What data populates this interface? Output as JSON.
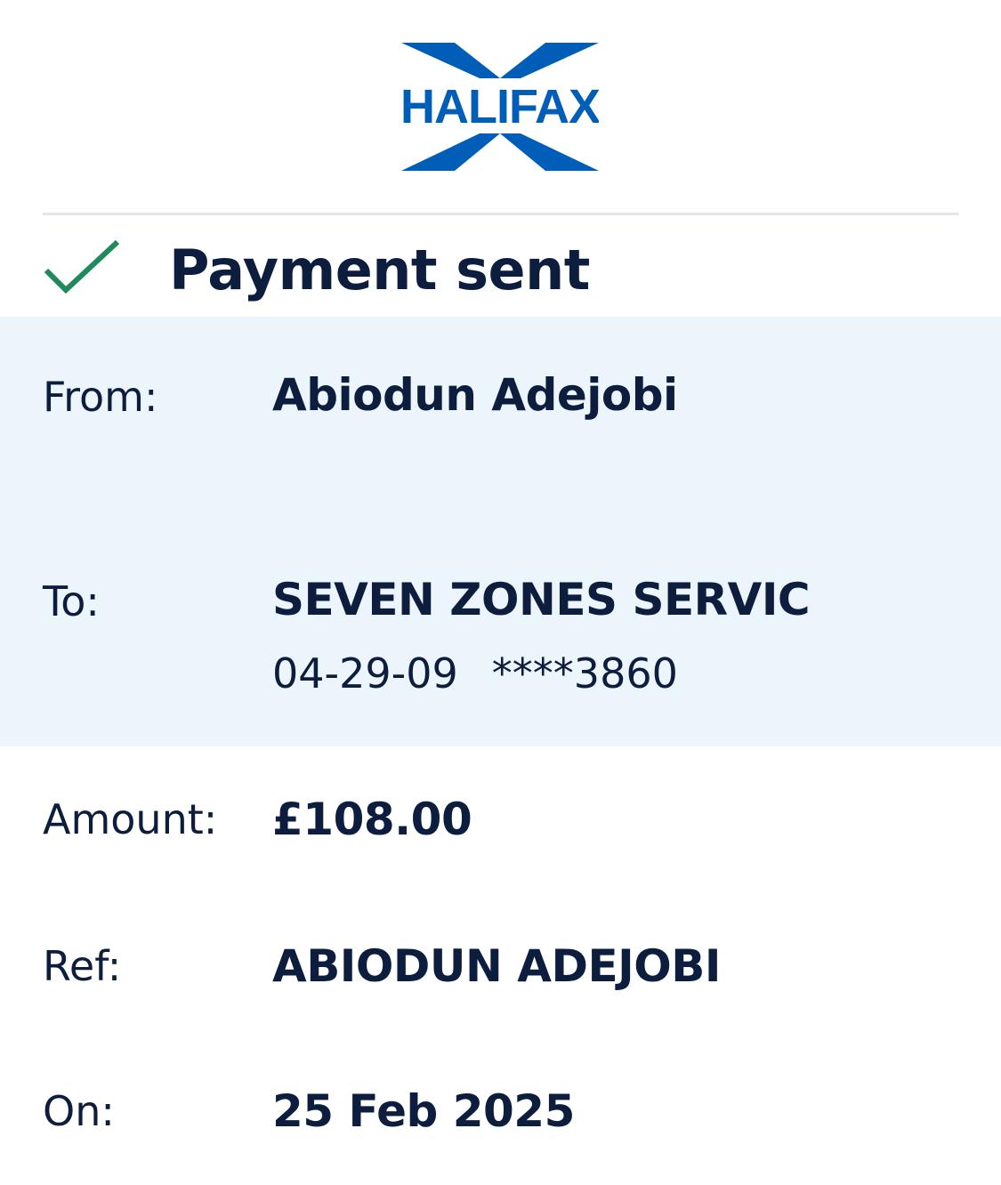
{
  "brand": {
    "name": "HALIFAX",
    "color": "#005eb8",
    "logo_icon": "halifax-x-logo-icon"
  },
  "status": {
    "icon": "checkmark-icon",
    "icon_color": "#1f8a5a",
    "title": "Payment sent"
  },
  "details": {
    "from": {
      "label": "From:",
      "value": "Abiodun Adejobi"
    },
    "to": {
      "label": "To:",
      "value": "SEVEN ZONES SERVIC",
      "sort_code": "04-29-09",
      "account": "****3860"
    },
    "amount": {
      "label": "Amount:",
      "value": "£108.00"
    },
    "ref": {
      "label": "Ref:",
      "value": "ABIODUN ADEJOBI"
    },
    "on": {
      "label": "On:",
      "value": "25 Feb 2025"
    }
  },
  "colors": {
    "text": "#0c1d3d",
    "panel_background": "#ecf4fc",
    "divider": "#e4e6ee"
  }
}
